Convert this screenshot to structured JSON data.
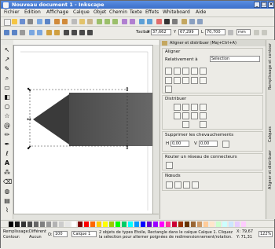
{
  "window": {
    "title": "Nouveau document 1 - Inkscape"
  },
  "menu": [
    "Fichier",
    "Édition",
    "Affichage",
    "Calque",
    "Objet",
    "Chemin",
    "Texte",
    "Effets",
    "Whiteboard",
    "Aide"
  ],
  "toolbar2": {
    "x_label": "X",
    "x_value": "37,662",
    "y_label": "Y",
    "y_value": "67,299",
    "w_label": "L",
    "w_value": "70,700",
    "unit": "mm",
    "tool_label": "Toolbar"
  },
  "panel": {
    "title": "Aligner et distribuer (Maj+Ctrl+A)",
    "align_title": "Aligner",
    "relative_label": "Relativement à",
    "relative_value": "Sélection",
    "distribute_title": "Distribuer",
    "overlap_title": "Supprimer les chevauchements",
    "overlap_h_label": "H",
    "overlap_h_value": "0,00",
    "overlap_v_label": "V",
    "overlap_v_value": "0,00",
    "connector_title": "Router un réseau de connecteurs",
    "nodes_title": "Nœuds"
  },
  "sidetabs": [
    "Remplissage et contour",
    "Calques",
    "Aligner et distribuer"
  ],
  "status": {
    "layer_label": "Calque 1",
    "message": "2 objets de types Étoile, Rectangle dans le calque Calque 1. Cliquez la sélection pour alterner poignées de redimensionnement/rotation.",
    "opacity_label": "O:",
    "opacity_value": "100",
    "x_coord": "X: 79,67",
    "y_coord": "Y: 71,31",
    "zoom": "122%",
    "fill_label": "Remplissage:",
    "fill_value": "Différent",
    "stroke_label": "Contour:",
    "stroke_value": "Aucun"
  },
  "palette_colors": [
    "#000000",
    "#1a1a1a",
    "#333333",
    "#4d4d4d",
    "#666666",
    "#808080",
    "#999999",
    "#b3b3b3",
    "#cccccc",
    "#e6e6e6",
    "#ffffff",
    "#800000",
    "#ff0000",
    "#ff6600",
    "#ffcc00",
    "#ffff00",
    "#99cc00",
    "#00ff00",
    "#00cc66",
    "#00ffff",
    "#0099ff",
    "#0000ff",
    "#6600cc",
    "#9900ff",
    "#ff00ff",
    "#ff3399",
    "#cc0033",
    "#993300",
    "#663300",
    "#996633",
    "#cc9966",
    "#ffcc99",
    "#ffe6cc",
    "#ccffcc",
    "#ccffff",
    "#cce6ff",
    "#e6ccff",
    "#ffccff"
  ]
}
